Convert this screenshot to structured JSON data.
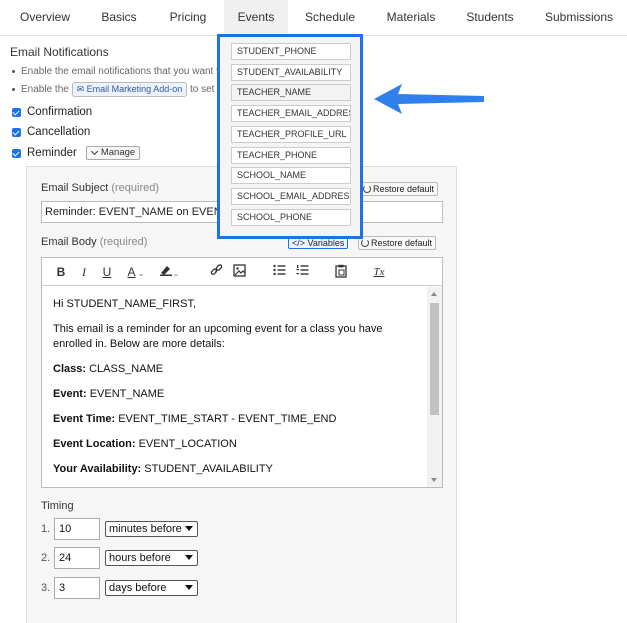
{
  "tabs": [
    {
      "label": "Overview"
    },
    {
      "label": "Basics"
    },
    {
      "label": "Pricing"
    },
    {
      "label": "Events"
    },
    {
      "label": "Schedule"
    },
    {
      "label": "Materials"
    },
    {
      "label": "Students"
    },
    {
      "label": "Submissions"
    }
  ],
  "active_tab": "Events",
  "section": {
    "title": "Email Notifications",
    "bullet1": "Enable the email notifications that you want t",
    "bullet2_prefix": "Enable the",
    "addon_label": "Email Marketing Add-on",
    "bullet2_suffix": "to set t"
  },
  "checkboxes": [
    {
      "label": "Confirmation",
      "checked": true
    },
    {
      "label": "Cancellation",
      "checked": true
    },
    {
      "label": "Reminder",
      "checked": true
    }
  ],
  "manage_label": "Manage",
  "subject": {
    "label": "Email Subject",
    "required": "(required)",
    "value": "Reminder: EVENT_NAME on EVENT_",
    "restore_label": "Restore default"
  },
  "body": {
    "label": "Email Body",
    "required": "(required)",
    "variables_label": "Variables",
    "restore_label": "Restore default",
    "paragraphs": {
      "greeting": "Hi STUDENT_NAME_FIRST,",
      "intro": "This email is a reminder for an upcoming event for a class you have enrolled in. Below are more details:",
      "class_label": "Class:",
      "class_value": "CLASS_NAME",
      "event_label": "Event:",
      "event_value": "EVENT_NAME",
      "time_label": "Event Time:",
      "time_value": "EVENT_TIME_START - EVENT_TIME_END",
      "location_label": "Event Location:",
      "location_value": "EVENT_LOCATION",
      "availability_label": "Your Availability:",
      "availability_value": "STUDENT_AVAILABILITY"
    },
    "toolbar_icons": [
      "bold-icon",
      "italic-icon",
      "underline-icon",
      "font-color-icon",
      "highlight-icon",
      "link-icon",
      "image-icon",
      "bulleted-list-icon",
      "numbered-list-icon",
      "paste-icon",
      "clear-format-icon"
    ],
    "toolbar_glyphs": {
      "bold": "B",
      "italic": "I",
      "underline": "U",
      "font_color": "A",
      "clear": "Tx"
    }
  },
  "timing": {
    "label": "Timing",
    "rows": [
      {
        "num": "1.",
        "value": "10",
        "unit": "minutes before"
      },
      {
        "num": "2.",
        "value": "24",
        "unit": "hours before"
      },
      {
        "num": "3.",
        "value": "3",
        "unit": "days before"
      }
    ]
  },
  "variables_popup": [
    "STUDENT_PHONE",
    "STUDENT_AVAILABILITY",
    "TEACHER_NAME",
    "TEACHER_EMAIL_ADDRESS",
    "TEACHER_PROFILE_URL",
    "TEACHER_PHONE",
    "SCHOOL_NAME",
    "SCHOOL_EMAIL_ADDRESS",
    "SCHOOL_PHONE"
  ],
  "colors": {
    "accent": "#1a73e8",
    "annotation_arrow": "#2f80ed"
  }
}
